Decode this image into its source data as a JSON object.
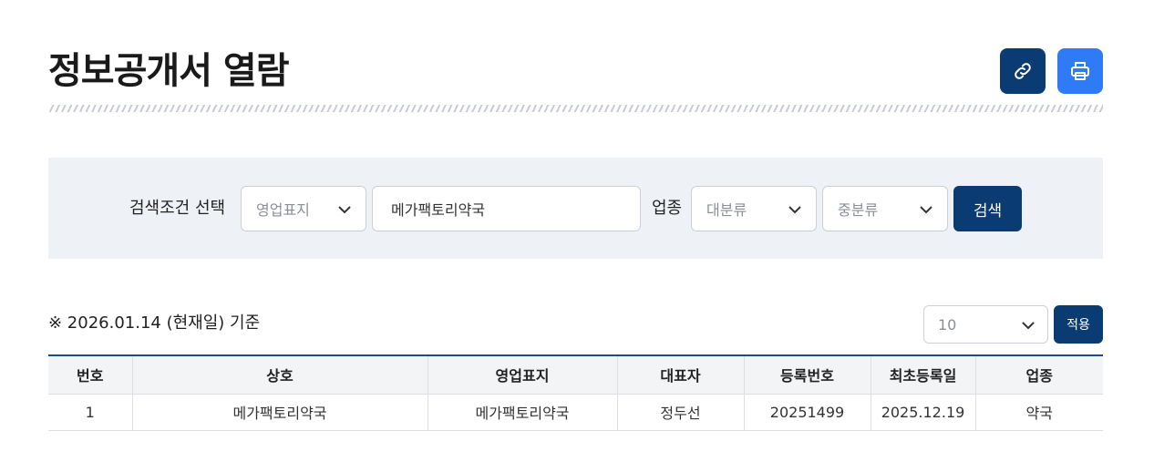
{
  "page": {
    "title": "정보공개서 열람"
  },
  "icons": {
    "link": "link-icon",
    "print": "printer-icon"
  },
  "colors": {
    "primary": "#0b3b73",
    "print_button": "#2f7bf5",
    "panel_bg": "#eef1f6",
    "table_top_border": "#1c4f7c"
  },
  "search": {
    "condition_label": "검색조건 선택",
    "condition_select": "영업표지",
    "keyword_value": "메가팩토리약국",
    "industry_label": "업종",
    "major_category": "대분류",
    "middle_category": "중분류",
    "search_button": "검색"
  },
  "results": {
    "basis_text": "※ 2026.01.14 (현재일) 기준",
    "page_size": "10",
    "apply_button": "적용",
    "columns": [
      "번호",
      "상호",
      "영업표지",
      "대표자",
      "등록번호",
      "최초등록일",
      "업종"
    ],
    "rows": [
      [
        "1",
        "메가팩토리약국",
        "메가팩토리약국",
        "정두선",
        "20251499",
        "2025.12.19",
        "약국"
      ]
    ]
  }
}
